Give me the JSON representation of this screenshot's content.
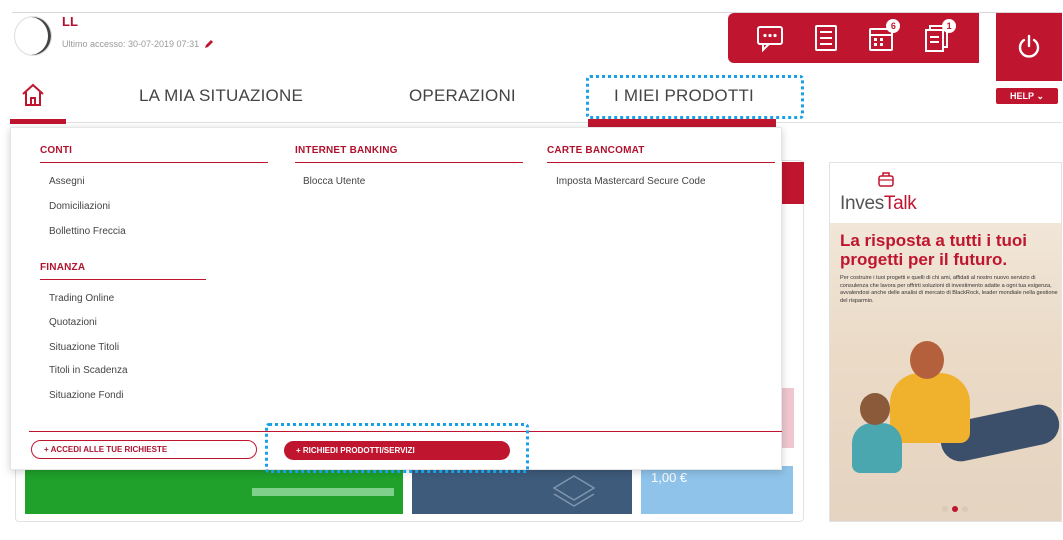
{
  "header": {
    "user_name": "LL",
    "last_access_label": "Ultimo accesso: 30-07-2019 07:31",
    "help_label": "HELP",
    "toolbar": {
      "messages_icon": "chat-icon",
      "list_icon": "list-icon",
      "calendar_badge": "6",
      "documents_badge": "1"
    }
  },
  "nav": {
    "items": [
      {
        "label": "LA MIA SITUAZIONE"
      },
      {
        "label": "OPERAZIONI"
      },
      {
        "label": "I MIEI PRODOTTI"
      }
    ]
  },
  "menu": {
    "conti": {
      "title": "CONTI",
      "items": [
        "Assegni",
        "Domiciliazioni",
        "Bollettino Freccia"
      ]
    },
    "finanza": {
      "title": "FINANZA",
      "items": [
        "Trading Online",
        "Quotazioni",
        "Situazione Titoli",
        "Titoli in Scadenza",
        "Situazione Fondi"
      ]
    },
    "internet_banking": {
      "title": "INTERNET BANKING",
      "items": [
        "Blocca Utente"
      ]
    },
    "carte_bancomat": {
      "title": "CARTE BANCOMAT",
      "items": [
        "Imposta Mastercard Secure Code"
      ]
    },
    "buttons": {
      "requests": "+ ACCEDI ALLE TUE RICHIESTE",
      "request_products": "+ RICHIEDI PRODOTTI/SERVIZI"
    }
  },
  "background": {
    "card_value": "1,00 €"
  },
  "ad": {
    "logo_part1": "Inves",
    "logo_part2": "Talk",
    "headline": "La risposta a tutti i tuoi progetti per il futuro.",
    "copy": "Per costruire i tuoi progetti e quelli di chi ami, affidati al nostro nuovo servizio di consulenza che lavora per offrirti soluzioni di investimento adatte a ogni tua esigenza, avvalendosi anche delle analisi di mercato di BlackRock, leader mondiale nella gestione del risparmio."
  },
  "colors": {
    "brand_red": "#c0152f",
    "focus_blue": "#1aa0e6"
  }
}
